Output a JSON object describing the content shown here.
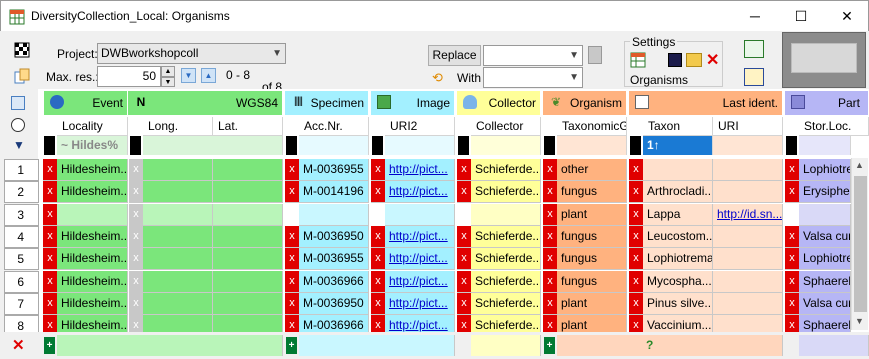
{
  "window": {
    "title": "DiversityCollection_Local: Organisms",
    "minimize": "─",
    "maximize": "☐",
    "close": "✕"
  },
  "toolbar": {
    "project_label": "Project:",
    "project_value": "DWBworkshopcoll",
    "maxres_label": "Max. res.:",
    "maxres_value": "50",
    "range": "0 - 8",
    "of": "of 8",
    "replace_label": "Replace",
    "with_label": "With",
    "settings_label": "Settings",
    "organisms_label": "Organisms"
  },
  "groups": [
    {
      "label": "Event",
      "color": "#7be67b"
    },
    {
      "label": "WGS84",
      "color": "#7be67b"
    },
    {
      "label": "Specimen",
      "color": "#a3f0ff"
    },
    {
      "label": "Image",
      "color": "#a3f0ff"
    },
    {
      "label": "Collector",
      "color": "#ffff99"
    },
    {
      "label": "Organism",
      "color": "#ffb27f"
    },
    {
      "label": "Last ident.",
      "color": "#ffb27f"
    },
    {
      "label": "Part",
      "color": "#b6b6f5"
    }
  ],
  "columns": [
    "Locality",
    "Long.",
    "Lat.",
    "Acc.Nr.",
    "URI2",
    "Collector",
    "TaxonomicGr",
    "Taxon",
    "URI",
    "Stor.Loc."
  ],
  "filters": {
    "locality": "~ Hildes%",
    "taxon": "1↑"
  },
  "rows": [
    {
      "num": "1",
      "locality": "Hildesheim...",
      "accnr": "M-0036955",
      "uri2": "http://pict...",
      "collector": "Schieferde...",
      "taxgroup": "other",
      "taxon": "",
      "uri": "",
      "storloc": "Lophiotrema"
    },
    {
      "num": "2",
      "locality": "Hildesheim...",
      "accnr": "M-0014196",
      "uri2": "http://pict...",
      "collector": "Schieferde...",
      "taxgroup": "fungus",
      "taxon": "Arthrocladi...",
      "uri": "",
      "storloc": "Erysiphe c"
    },
    {
      "num": "3",
      "locality": "",
      "accnr": "",
      "uri2": "",
      "collector": "",
      "taxgroup": "plant",
      "taxon": "Lappa",
      "uri": "http://id.sn...",
      "storloc": ""
    },
    {
      "num": "4",
      "locality": "Hildesheim...",
      "accnr": "M-0036950",
      "uri2": "http://pict...",
      "collector": "Schieferde...",
      "taxgroup": "fungus",
      "taxon": "Leucostom...",
      "uri": "",
      "storloc": "Valsa cum"
    },
    {
      "num": "5",
      "locality": "Hildesheim...",
      "accnr": "M-0036955",
      "uri2": "http://pict...",
      "collector": "Schieferde...",
      "taxgroup": "fungus",
      "taxon": "Lophiotrema",
      "uri": "",
      "storloc": "Lophiotrem"
    },
    {
      "num": "6",
      "locality": "Hildesheim...",
      "accnr": "M-0036966",
      "uri2": "http://pict...",
      "collector": "Schieferde...",
      "taxgroup": "fungus",
      "taxon": "Mycospha...",
      "uri": "",
      "storloc": "Sphaerella"
    },
    {
      "num": "7",
      "locality": "Hildesheim...",
      "accnr": "M-0036950",
      "uri2": "http://pict...",
      "collector": "Schieferde...",
      "taxgroup": "plant",
      "taxon": "Pinus silve...",
      "uri": "",
      "storloc": "Valsa cum"
    },
    {
      "num": "8",
      "locality": "Hildesheim...",
      "accnr": "M-0036966",
      "uri2": "http://pict...",
      "collector": "Schieferde...",
      "taxgroup": "plant",
      "taxon": "Vaccinium...",
      "uri": "",
      "storloc": "Sphaerella"
    }
  ],
  "bottom": {
    "question": "?",
    "delete": "✕",
    "add": "+"
  }
}
